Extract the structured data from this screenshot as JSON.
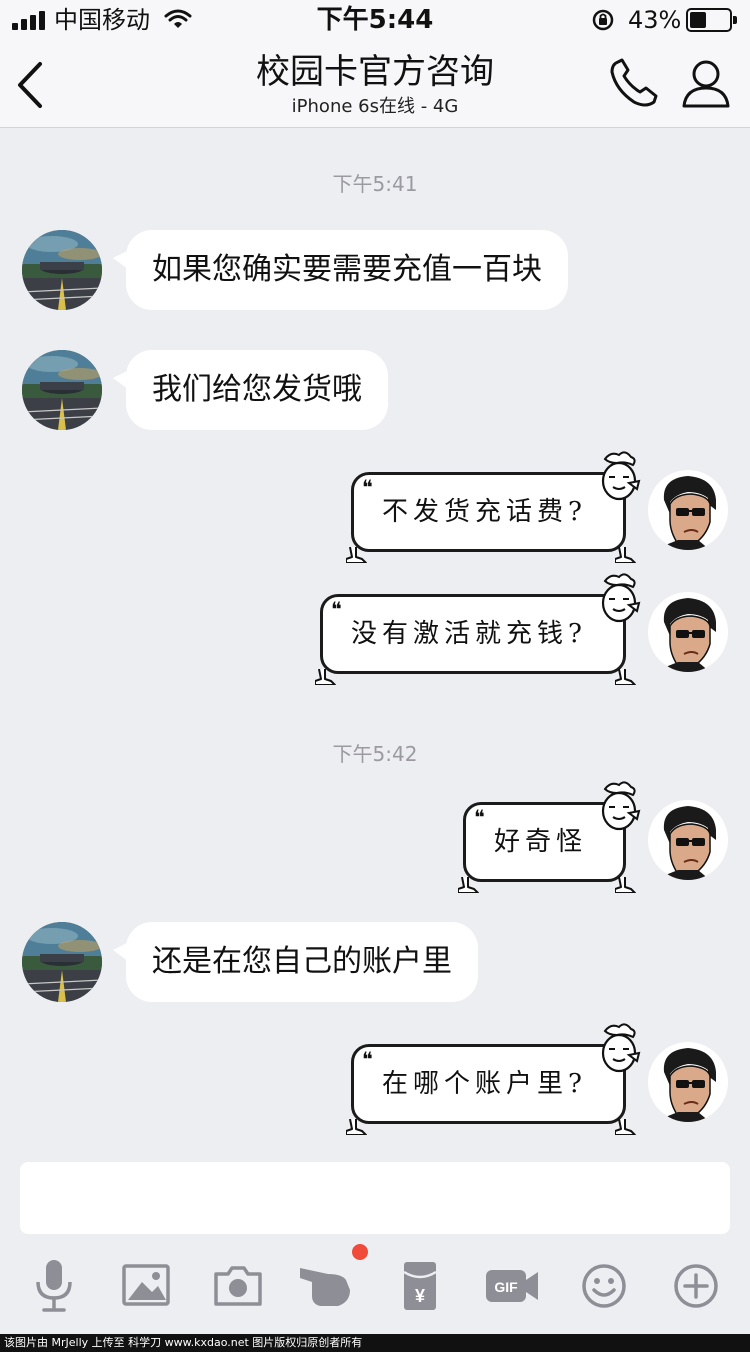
{
  "status_bar": {
    "carrier": "中国移动",
    "time": "下午5:44",
    "battery": "43%",
    "battery_level": 0.43
  },
  "header": {
    "title": "校园卡官方咨询",
    "subtitle": "iPhone 6s在线 - 4G"
  },
  "timestamps": [
    "下午5:41",
    "下午5:42"
  ],
  "messages": [
    {
      "sender": "other",
      "text": "如果您确实要需要充值一百块"
    },
    {
      "sender": "other",
      "text": "我们给您发货哦"
    },
    {
      "sender": "me",
      "text": "不发货充话费?"
    },
    {
      "sender": "me",
      "text": "没有激活就充钱?"
    },
    {
      "sender": "me",
      "text": "好奇怪"
    },
    {
      "sender": "other",
      "text": "还是在您自己的账户里"
    },
    {
      "sender": "me",
      "text": "在哪个账户里?"
    }
  ],
  "input": {
    "value": ""
  },
  "toolbar": {
    "icons": [
      "microphone-icon",
      "image-icon",
      "camera-icon",
      "poke-hand-icon",
      "red-packet-icon",
      "gif-icon",
      "emoji-icon",
      "plus-icon"
    ],
    "red_packet_symbol": "¥",
    "gif_label": "GIF",
    "notification_dot_color": "#f04a3a"
  },
  "watermark": "该图片由 MrJelly 上传至 科学刀 www.kxdao.net 图片版权归原创者所有",
  "colors": {
    "background": "#edeef2",
    "bubble_incoming": "#ffffff",
    "bubble_outgoing_border": "#1b1b1b",
    "timestamp": "#9a9aa0",
    "toolbar_icon": "#8e8e96"
  }
}
